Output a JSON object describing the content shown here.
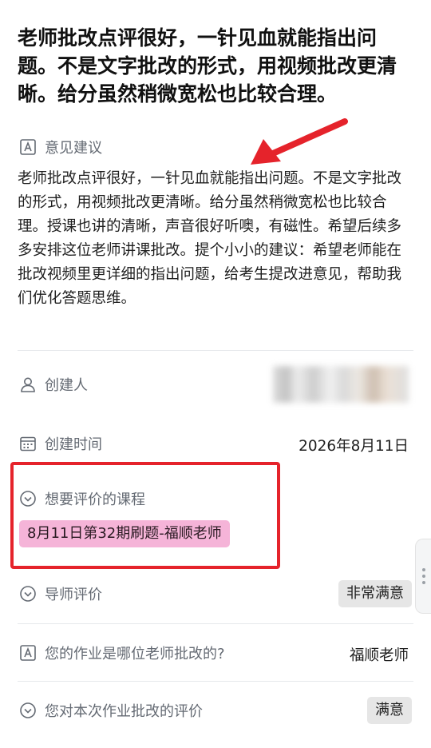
{
  "title": "老师批改点评很好，一针见血就能指出问题。不是文字批改的形式，用视频批改更清晰。给分虽然稍微宽松也比较合理。",
  "suggestion": {
    "label": "意见建议",
    "icon": "letter-a-icon",
    "text": "老师批改点评很好，一针见血就能指出问题。不是文字批改的形式，用视频批改更清晰。给分虽然稍微宽松也比较合理。授课也讲的清晰，声音很好听噢，有磁性。希望后续多多安排这位老师讲课批改。提个小小的建议：希望老师能在批改视频里更详细的指出问题，给考生提改进意见，帮助我们优化答题思维。"
  },
  "creator": {
    "label": "创建人",
    "icon": "person-icon"
  },
  "created_time": {
    "label": "创建时间",
    "icon": "calendar-icon",
    "value": "2026年8月11日"
  },
  "course": {
    "label": "想要评价的课程",
    "icon": "circle-chevron-down-icon",
    "value": "8月11日第32期刷题-福顺老师"
  },
  "mentor_rating": {
    "label": "导师评价",
    "icon": "circle-chevron-down-icon",
    "value": "非常满意"
  },
  "homework_teacher": {
    "label": "您的作业是哪位老师批改的?",
    "icon": "letter-a-icon",
    "value": "福顺老师"
  },
  "homework_rating": {
    "label": "您对本次作业批改的评价",
    "icon": "circle-chevron-down-icon",
    "value": "满意"
  },
  "colors": {
    "annotation": "#e5232b",
    "tag_pink": "#f5b4d8",
    "tag_grey": "#e6e6e6"
  }
}
